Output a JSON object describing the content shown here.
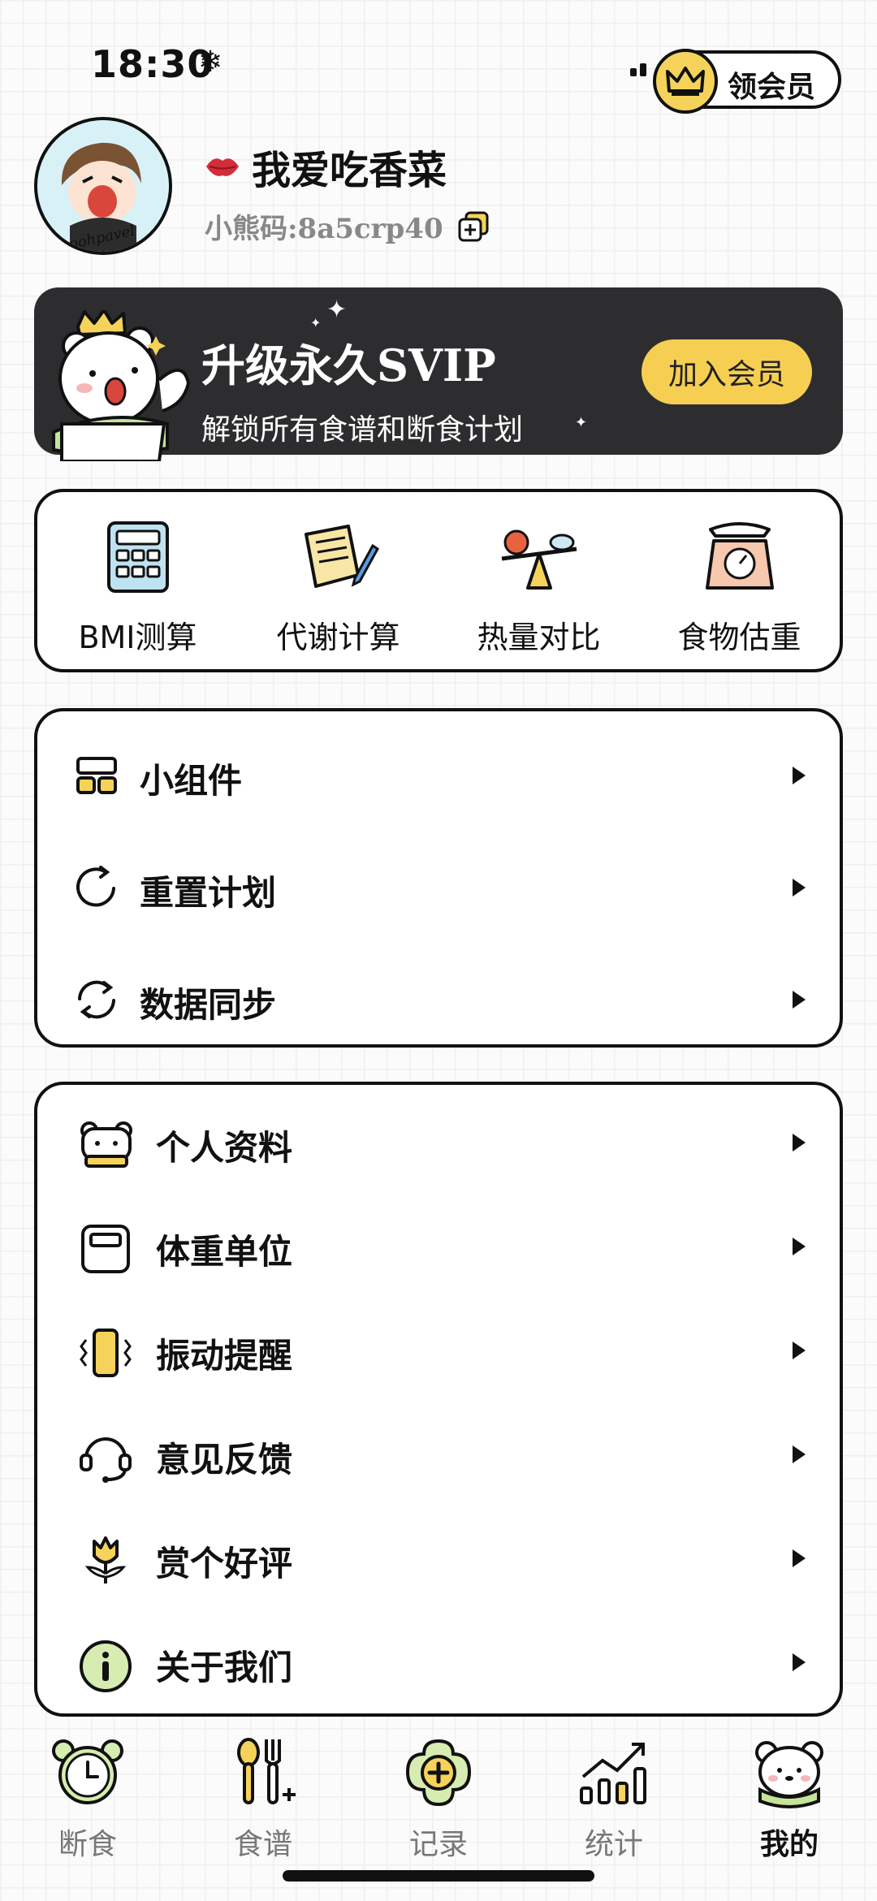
{
  "status_bar": {
    "time": "18:30",
    "extra_icon": "snowflake"
  },
  "member_pill": {
    "label": "领会员"
  },
  "profile": {
    "username": "我爱吃香菜",
    "code": "小熊码:8a5crp40",
    "avatar_text": "poohpavel"
  },
  "banner": {
    "title": "升级永久SVIP",
    "subtitle": "解锁所有食谱和断食计划",
    "button": "加入会员",
    "colors": {
      "background": "#2d2d2f",
      "button": "#f6cf52"
    }
  },
  "tools": [
    {
      "label": "BMI测算",
      "icon": "calculator-icon"
    },
    {
      "label": "代谢计算",
      "icon": "notes-pen-icon"
    },
    {
      "label": "热量对比",
      "icon": "balance-icon"
    },
    {
      "label": "食物估重",
      "icon": "kitchen-scale-icon"
    }
  ],
  "menu_group_1": [
    {
      "label": "小组件",
      "icon": "widget-icon"
    },
    {
      "label": "重置计划",
      "icon": "refresh-icon"
    },
    {
      "label": "数据同步",
      "icon": "sync-icon"
    }
  ],
  "menu_group_2": [
    {
      "label": "个人资料",
      "icon": "bear-profile-icon"
    },
    {
      "label": "体重单位",
      "icon": "scale-unit-icon"
    },
    {
      "label": "振动提醒",
      "icon": "vibration-icon"
    },
    {
      "label": "意见反馈",
      "icon": "headset-icon"
    },
    {
      "label": "赏个好评",
      "icon": "tulip-icon"
    },
    {
      "label": "关于我们",
      "icon": "info-icon"
    }
  ],
  "tabbar": [
    {
      "label": "断食",
      "icon": "alarm-clock-icon",
      "active": false
    },
    {
      "label": "食谱",
      "icon": "utensils-icon",
      "active": false
    },
    {
      "label": "记录",
      "icon": "add-record-icon",
      "active": false
    },
    {
      "label": "统计",
      "icon": "bar-chart-icon",
      "active": false
    },
    {
      "label": "我的",
      "icon": "bear-face-icon",
      "active": true
    }
  ],
  "accent_color": "#f6cf52"
}
